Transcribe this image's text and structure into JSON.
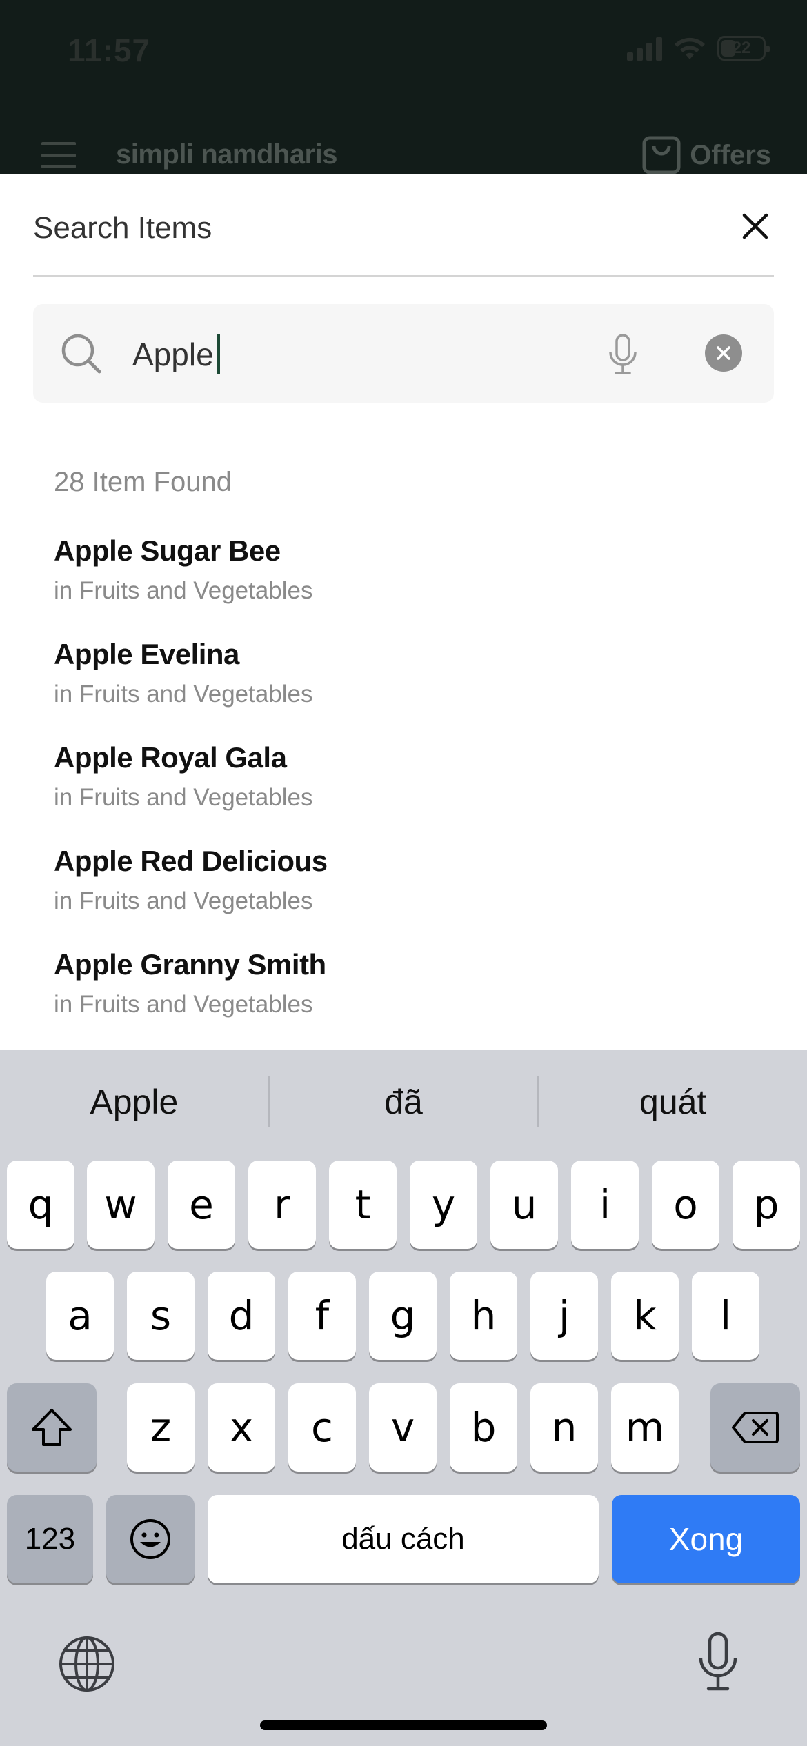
{
  "status_bar": {
    "time": "11:57",
    "battery": "22"
  },
  "app_header": {
    "brand": "simpli namdharis",
    "offers_label": "Offers",
    "menu_icon": "hamburger-icon",
    "offers_icon": "bag-icon"
  },
  "search_sheet": {
    "title": "Search Items",
    "query": "Apple",
    "results_count_text": "28 Item Found",
    "results": [
      {
        "name": "Apple Sugar Bee",
        "category": "in Fruits and Vegetables"
      },
      {
        "name": "Apple Evelina",
        "category": "in Fruits and Vegetables"
      },
      {
        "name": "Apple Royal Gala",
        "category": "in Fruits and Vegetables"
      },
      {
        "name": "Apple Red Delicious",
        "category": "in Fruits and Vegetables"
      },
      {
        "name": "Apple Granny Smith",
        "category": "in Fruits and Vegetables"
      }
    ]
  },
  "keyboard": {
    "suggestions": [
      "Apple",
      "đã",
      "quát"
    ],
    "row1": [
      "q",
      "w",
      "e",
      "r",
      "t",
      "y",
      "u",
      "i",
      "o",
      "p"
    ],
    "row2": [
      "a",
      "s",
      "d",
      "f",
      "g",
      "h",
      "j",
      "k",
      "l"
    ],
    "row3": [
      "z",
      "x",
      "c",
      "v",
      "b",
      "n",
      "m"
    ],
    "numbers_label": "123",
    "space_label": "dấu cách",
    "done_label": "Xong"
  },
  "colors": {
    "header_bg": "#121c19",
    "done_key": "#2f7bf5",
    "caret": "#1d4a36"
  }
}
